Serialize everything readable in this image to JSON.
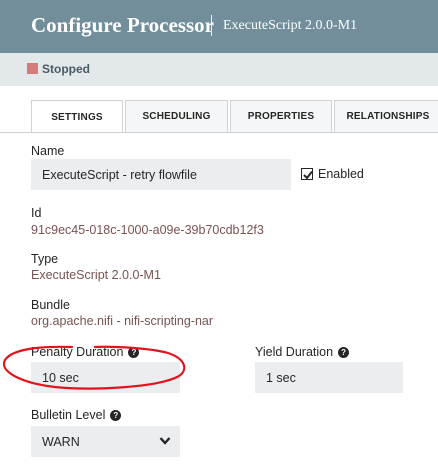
{
  "header": {
    "title": "Configure Processor",
    "subtitle": "ExecuteScript 2.0.0-M1"
  },
  "status": {
    "text": "Stopped",
    "color": "#d67b7b"
  },
  "tabs": [
    {
      "label": "SETTINGS",
      "active": true
    },
    {
      "label": "SCHEDULING",
      "active": false
    },
    {
      "label": "PROPERTIES",
      "active": false
    },
    {
      "label": "RELATIONSHIPS",
      "active": false
    }
  ],
  "settings": {
    "name_label": "Name",
    "name_value": "ExecuteScript - retry flowfile",
    "enabled_label": "Enabled",
    "enabled": true,
    "id_label": "Id",
    "id_value": "91c9ec45-018c-1000-a09e-39b70cdb12f3",
    "type_label": "Type",
    "type_value": "ExecuteScript 2.0.0-M1",
    "bundle_label": "Bundle",
    "bundle_value": "org.apache.nifi - nifi-scripting-nar",
    "penalty_label": "Penalty Duration",
    "penalty_value": "10 sec",
    "yield_label": "Yield Duration",
    "yield_value": "1 sec",
    "bulletin_label": "Bulletin Level",
    "bulletin_value": "WARN"
  },
  "annotation_color": "#e0141b"
}
